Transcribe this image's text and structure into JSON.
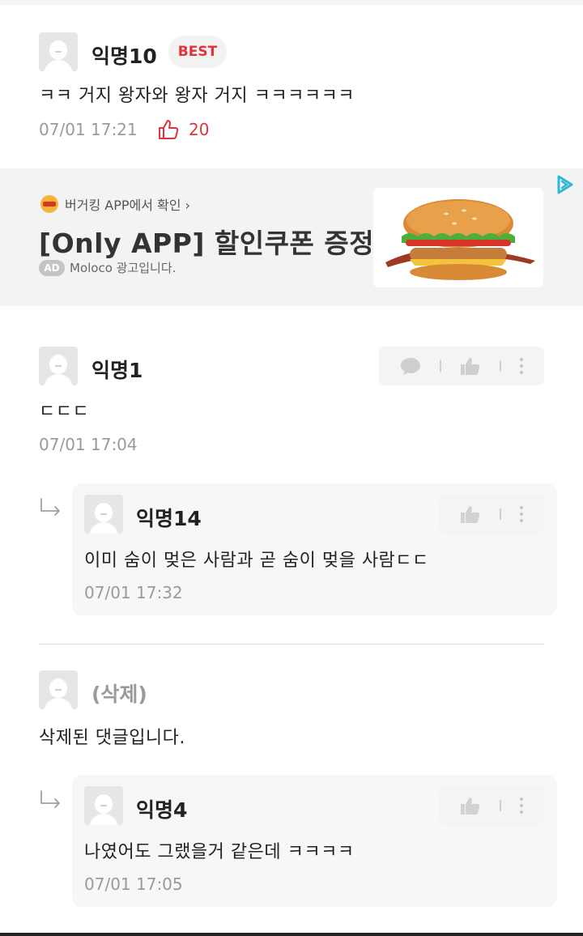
{
  "best_comment": {
    "nickname": "익명10",
    "badge": "BEST",
    "content": "ㅋㅋ 거지 왕자와 왕자 거지 ㅋㅋㅋㅋㅋㅋ",
    "time": "07/01 17:21",
    "likes": "20"
  },
  "ad": {
    "brand": "버거킹 APP에서 확인 ›",
    "title": "[Only APP] 할인쿠폰 증정",
    "pill": "AD",
    "advertiser": "Moloco 광고입니다."
  },
  "comments": [
    {
      "nickname": "익명1",
      "content": "ㄷㄷㄷ",
      "time": "07/01 17:04",
      "reply": {
        "nickname": "익명14",
        "content": "이미 숨이 멎은 사람과 곧 숨이 멎을 사람ㄷㄷ",
        "time": "07/01 17:32"
      }
    },
    {
      "nickname": "(삭제)",
      "content": "삭제된 댓글입니다.",
      "reply": {
        "nickname": "익명4",
        "content": "나였어도 그랬을거 같은데 ㅋㅋㅋㅋ",
        "time": "07/01 17:05"
      }
    }
  ],
  "colors": {
    "accent_red": "#e0343a",
    "muted_text": "#9a9a9a",
    "ad_background": "#f3f3f3"
  },
  "icons": [
    "avatar-placeholder",
    "thumbs-up-icon",
    "comment-bubble-icon",
    "more-dots-icon",
    "reply-arrow-icon",
    "ad-choices-icon",
    "burger-king-logo"
  ]
}
